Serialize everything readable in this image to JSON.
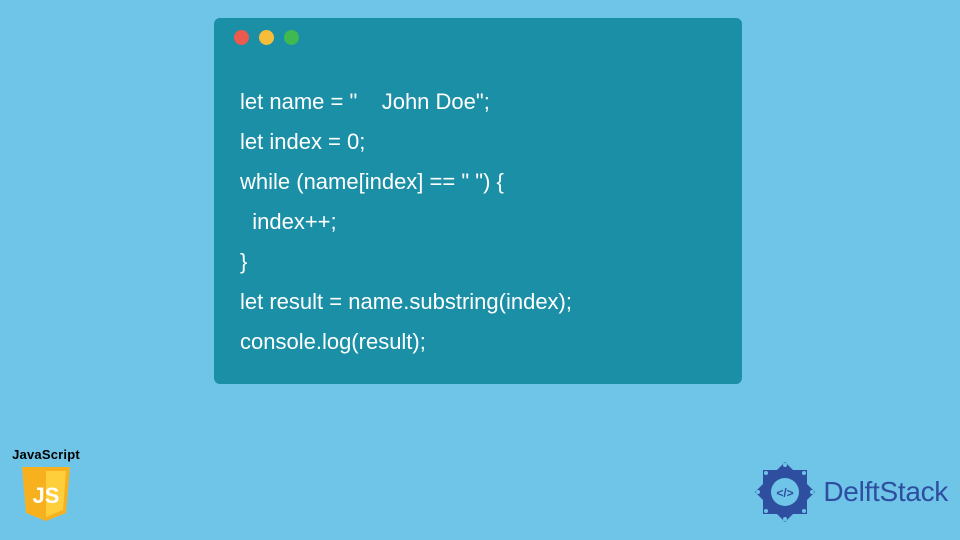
{
  "language_badge": {
    "label": "JavaScript",
    "shield_text": "JS"
  },
  "brand": {
    "name": "DelftStack"
  },
  "code_window": {
    "dots": [
      "red",
      "yellow",
      "green"
    ],
    "code": "let name = \"    John Doe\";\nlet index = 0;\nwhile (name[index] == \" \") {\n  index++;\n}\nlet result = name.substring(index);\nconsole.log(result);"
  }
}
